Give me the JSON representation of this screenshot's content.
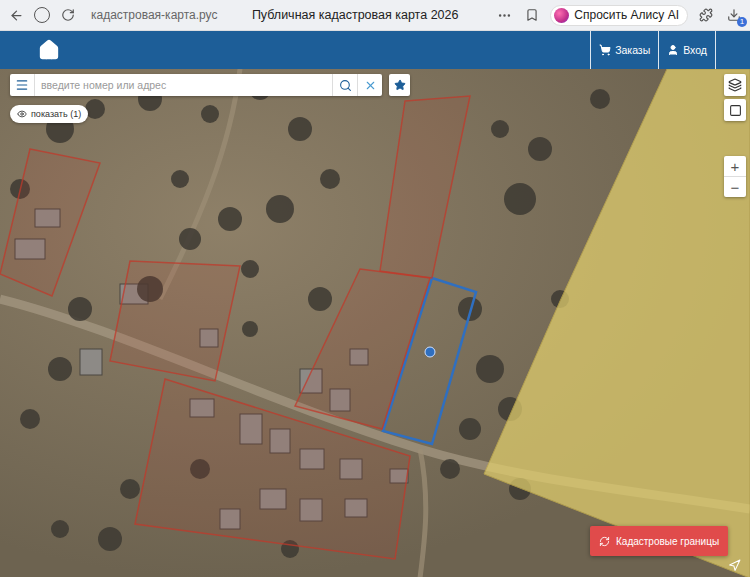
{
  "browser": {
    "address": "кадастровая-карта.рус",
    "title": "Публичная кадастровая карта 2026",
    "assistant": "Спросить Алису AI",
    "badge": "1"
  },
  "header": {
    "nav": [
      {
        "label": "Заказы",
        "icon": "cart"
      },
      {
        "label": "Вход",
        "icon": "user"
      }
    ]
  },
  "search": {
    "placeholder": "введите номер или адрес"
  },
  "layer_toggle": {
    "label": "показать (1)"
  },
  "zoom": {
    "in": "+",
    "out": "−"
  },
  "cadastral_button": {
    "label": "Кадастровые границы"
  },
  "map": {
    "zone_color": "#e3d06e",
    "parcels": [
      {
        "selected": true,
        "color": "#2f6fc0"
      },
      {
        "selected": false,
        "color": "#c0392b"
      },
      {
        "selected": false,
        "color": "#c0392b"
      },
      {
        "selected": false,
        "color": "#c0392b"
      },
      {
        "selected": false,
        "color": "#c0392b"
      },
      {
        "selected": false,
        "color": "#c0392b"
      }
    ]
  }
}
